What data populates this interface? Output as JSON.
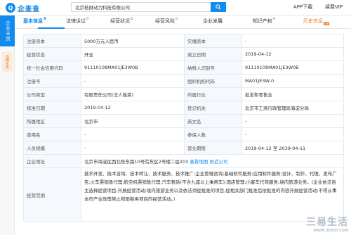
{
  "header": {
    "logo_icon": "Q",
    "logo_text": "企查查",
    "logo_sub": "qichacha.com",
    "search_value": "北京桔财动力科技有限公司",
    "search_icon": "search-icon",
    "app_download": "APP下载",
    "account": "续费VIP"
  },
  "sidebar": {
    "main_label": "企业主页",
    "sub_label": "品牌主页"
  },
  "tabs": [
    {
      "label": "基本信息",
      "count": "8"
    },
    {
      "label": "法律诉讼",
      "count": "0"
    },
    {
      "label": "经营状况",
      "count": "0"
    },
    {
      "label": "经营风险",
      "count": "0"
    },
    {
      "label": "企业发展",
      "count": ""
    },
    {
      "label": "知识产权",
      "count": "0"
    },
    {
      "label": "历史信息",
      "count": "",
      "badge": "VIP"
    }
  ],
  "rows": [
    {
      "l1": "注册资本",
      "v1": "5000万元人民币",
      "l2": "实缴资本",
      "v2": "-"
    },
    {
      "l1": "经营状态",
      "v1": "开业",
      "l2": "成立日期",
      "v2": "2019-04-12"
    },
    {
      "l1": "统一社会信用代码",
      "v1": "91110108MA01JE3W0B",
      "l2": "纳税人识别号",
      "v2": "91110108MA01JE3W0B"
    },
    {
      "l1": "注册号",
      "v1": "-",
      "l2": "组织机构代码",
      "v2": "MA01JE3W-0"
    },
    {
      "l1": "公司类型",
      "v1": "有限责任公司(法人独资)",
      "l2": "所属行业",
      "v2": "批发和零售业"
    },
    {
      "l1": "核准日期",
      "v1": "2019-04-12",
      "l2": "登记机关",
      "v2": "北京市工商行政管理局海淀分局"
    },
    {
      "l1": "所属地区",
      "v1": "北京市",
      "l2": "英文名",
      "v2": "-"
    },
    {
      "l1": "曾用名",
      "v1": "-",
      "l2": "参保人数",
      "v2": "-"
    },
    {
      "l1": "人员规模",
      "v1": "-",
      "l2": "营业期限",
      "v2": "2019-04-12 至 2039-04-11"
    }
  ],
  "address": {
    "label": "企业地址",
    "value": "北京市海淀区西北旺东路10号院东区2号楼二层203",
    "map_link": "查看地图",
    "nearby_link": "附近公司"
  },
  "scope": {
    "label": "经营范围",
    "value": "技术开发、技术咨询、技术转让、技术服务、技术推广;企业管理咨询;基础软件服务;应用软件服务;设计、制作、代理、发布广告;火车票销售代理;航空机票销售代理;汽车租赁(不含九座以上乘用车);酒店管理;小客车代驾服务;境内旅游业务。(企业依法自主选择经营项目,开展经营活动;境内旅游业务以及依法须经批准的项目,经相关部门批准后依批准的内容开展经营活动;不得从事本市产业政策禁止和限制类项目的经营活动。)"
  },
  "watermark": {
    "text": "三易生活",
    "sub": "WWW.3EAST.COM"
  },
  "colors": {
    "accent": "#128bed",
    "label_bg": "#f5f8fc",
    "vip": "#e87a2b"
  }
}
